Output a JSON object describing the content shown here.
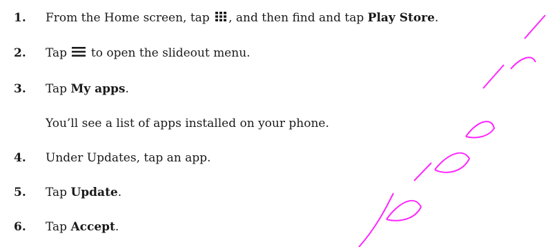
{
  "watermark": {
    "color": "#ff00ff"
  },
  "icons": {
    "apps": "apps-grid-icon",
    "menu": "hamburger-menu-icon"
  },
  "steps": [
    {
      "number": "1.",
      "before": "From the Home screen, tap",
      "middle": ", and then find and tap",
      "bold": "Play Store",
      "after": "."
    },
    {
      "number": "2.",
      "before": "Tap",
      "after": "to open the slideout menu."
    },
    {
      "number": "3.",
      "before": "Tap",
      "bold": "My apps",
      "after": "."
    },
    {
      "note": "You’ll see a list of apps installed on your phone."
    },
    {
      "number": "4.",
      "text": "Under Updates, tap an app."
    },
    {
      "number": "5.",
      "before": "Tap",
      "bold": "Update",
      "after": "."
    },
    {
      "number": "6.",
      "before": "Tap",
      "bold": "Accept",
      "after": "."
    }
  ]
}
